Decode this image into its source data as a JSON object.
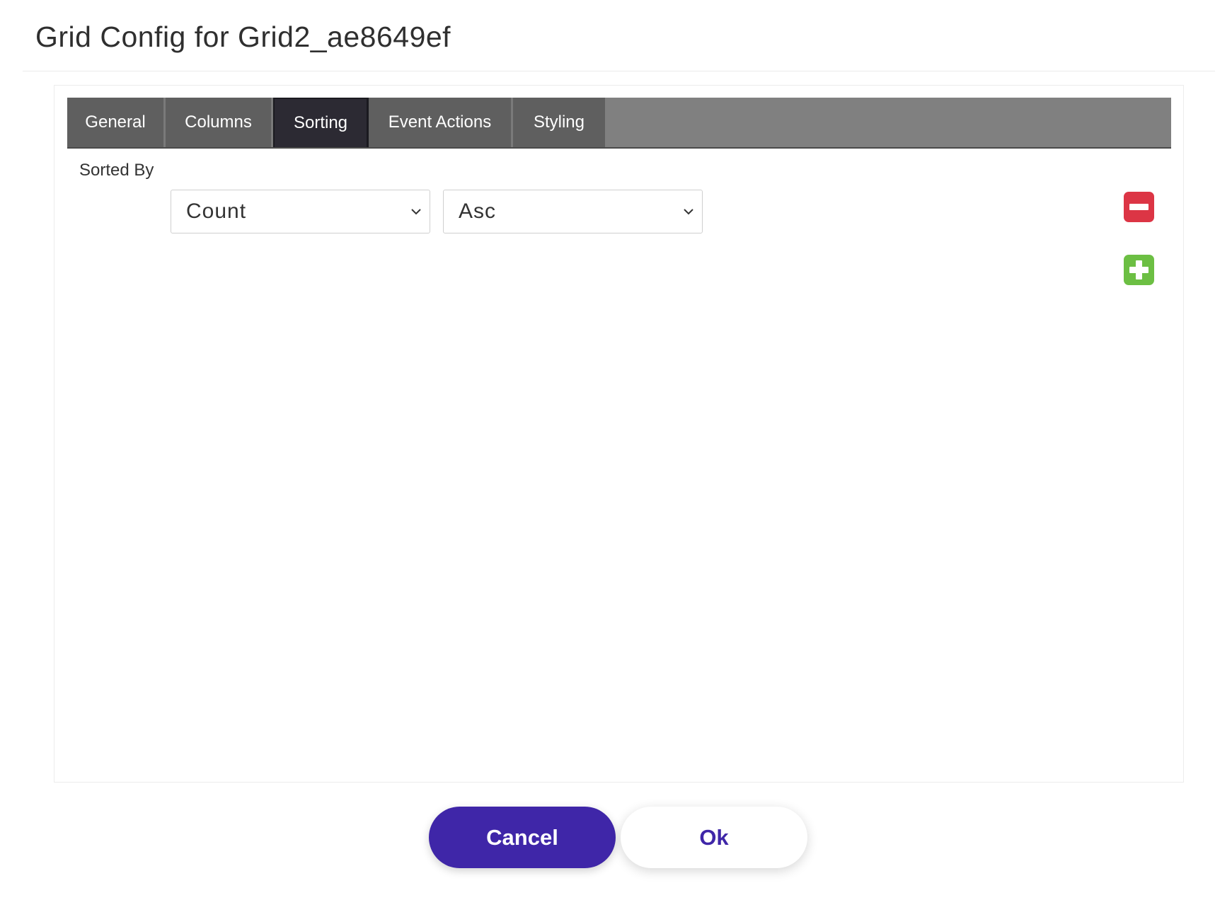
{
  "dialog": {
    "title": "Grid Config for Grid2_ae8649ef"
  },
  "tabs": [
    {
      "label": "General",
      "active": false
    },
    {
      "label": "Columns",
      "active": false
    },
    {
      "label": "Sorting",
      "active": true
    },
    {
      "label": "Event Actions",
      "active": false
    },
    {
      "label": "Styling",
      "active": false
    }
  ],
  "sorting": {
    "label": "Sorted By",
    "rows": [
      {
        "column": "Count",
        "direction": "Asc"
      }
    ],
    "remove_icon": "minus-square-icon",
    "add_icon": "plus-square-icon"
  },
  "footer": {
    "cancel_label": "Cancel",
    "ok_label": "Ok"
  },
  "colors": {
    "accent": "#3f26a8",
    "remove": "#dc3545",
    "add": "#6cbf43",
    "tab_bg": "#5f5f5f",
    "tab_active_bg": "#2c2a33"
  }
}
